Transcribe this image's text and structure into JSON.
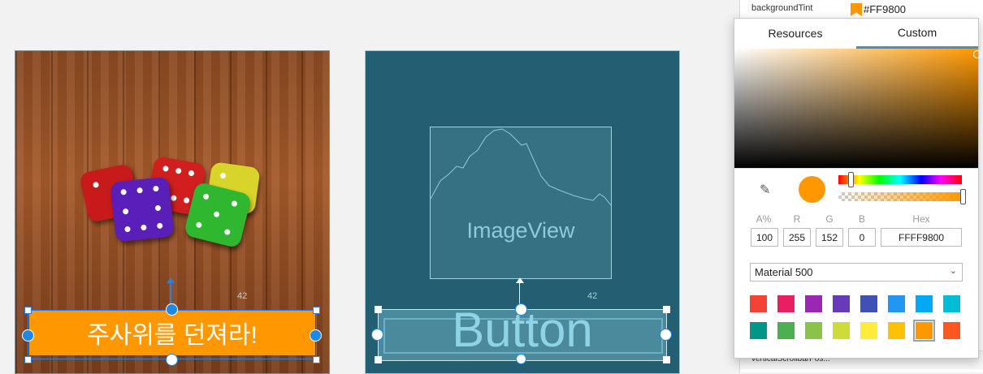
{
  "attributes": {
    "background_tint_label": "backgroundTint",
    "background_tint_value": "#FF9800",
    "vertical_scrollbar_label": "verticalScrollbarPos..."
  },
  "left_canvas": {
    "button_text": "주사위를 던져라!",
    "margin_label": "42"
  },
  "right_canvas": {
    "image_label": "ImageView",
    "button_label": "Button",
    "margin_label": "42"
  },
  "picker": {
    "tabs": [
      "Resources",
      "Custom"
    ],
    "active_tab": "Custom",
    "selected_color": "#FF9800",
    "fields": {
      "labels": [
        "A%",
        "R",
        "G",
        "B",
        "Hex"
      ],
      "values": [
        "100",
        "255",
        "152",
        "0",
        "FFFF9800"
      ]
    },
    "palette_name": "Material 500",
    "swatches": [
      "#F44336",
      "#E91E63",
      "#9C27B0",
      "#673AB7",
      "#3F51B5",
      "#2196F3",
      "#03A9F4",
      "#00BCD4",
      "#009688",
      "#4CAF50",
      "#8BC34A",
      "#CDDC39",
      "#FFEB3B",
      "#FFC107",
      "#FF9800",
      "#FF5722"
    ],
    "selected_swatch_index": 14
  }
}
